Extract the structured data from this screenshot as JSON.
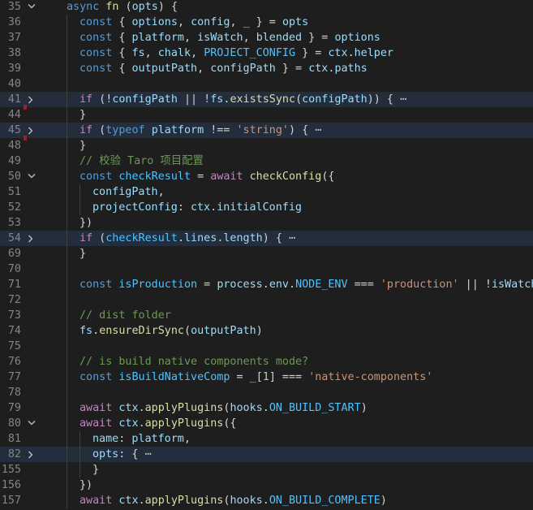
{
  "editor": {
    "colors": {
      "background": "#1e1e1e",
      "line_highlight": "#232d3c",
      "gutter_text": "#858585",
      "keyword": "#569cd6",
      "control": "#c586c0",
      "constant": "#4fc1ff",
      "variable": "#9cdcfe",
      "function": "#dcdcaa",
      "string": "#ce9178",
      "comment": "#6a9955",
      "plain": "#d4d4d4",
      "change_marker": "#a61c2a"
    },
    "lines": [
      {
        "num": "35",
        "indent": 0,
        "fold": "expanded",
        "highlight": false,
        "marker": false,
        "tokens": [
          [
            "kw",
            "async"
          ],
          [
            "op",
            " "
          ],
          [
            "fn",
            "fn"
          ],
          [
            "op",
            " ("
          ],
          [
            "var",
            "opts"
          ],
          [
            "op",
            ") {"
          ]
        ]
      },
      {
        "num": "36",
        "indent": 1,
        "fold": "none",
        "highlight": false,
        "marker": false,
        "tokens": [
          [
            "kw",
            "const"
          ],
          [
            "op",
            " { "
          ],
          [
            "var",
            "options"
          ],
          [
            "op",
            ", "
          ],
          [
            "var",
            "config"
          ],
          [
            "op",
            ", "
          ],
          [
            "var",
            "_"
          ],
          [
            "op",
            " } = "
          ],
          [
            "var",
            "opts"
          ]
        ]
      },
      {
        "num": "37",
        "indent": 1,
        "fold": "none",
        "highlight": false,
        "marker": false,
        "tokens": [
          [
            "kw",
            "const"
          ],
          [
            "op",
            " { "
          ],
          [
            "var",
            "platform"
          ],
          [
            "op",
            ", "
          ],
          [
            "var",
            "isWatch"
          ],
          [
            "op",
            ", "
          ],
          [
            "var",
            "blended"
          ],
          [
            "op",
            " } = "
          ],
          [
            "var",
            "options"
          ]
        ]
      },
      {
        "num": "38",
        "indent": 1,
        "fold": "none",
        "highlight": false,
        "marker": false,
        "tokens": [
          [
            "kw",
            "const"
          ],
          [
            "op",
            " { "
          ],
          [
            "var",
            "fs"
          ],
          [
            "op",
            ", "
          ],
          [
            "var",
            "chalk"
          ],
          [
            "op",
            ", "
          ],
          [
            "const",
            "PROJECT_CONFIG"
          ],
          [
            "op",
            " } = "
          ],
          [
            "var",
            "ctx"
          ],
          [
            "op",
            "."
          ],
          [
            "var",
            "helper"
          ]
        ]
      },
      {
        "num": "39",
        "indent": 1,
        "fold": "none",
        "highlight": false,
        "marker": false,
        "tokens": [
          [
            "kw",
            "const"
          ],
          [
            "op",
            " { "
          ],
          [
            "var",
            "outputPath"
          ],
          [
            "op",
            ", "
          ],
          [
            "var",
            "configPath"
          ],
          [
            "op",
            " } = "
          ],
          [
            "var",
            "ctx"
          ],
          [
            "op",
            "."
          ],
          [
            "var",
            "paths"
          ]
        ]
      },
      {
        "num": "40",
        "indent": 1,
        "fold": "none",
        "highlight": false,
        "marker": false,
        "tokens": []
      },
      {
        "num": "41",
        "indent": 1,
        "fold": "collapsed",
        "highlight": true,
        "marker": false,
        "tokens": [
          [
            "ctrl",
            "if"
          ],
          [
            "op",
            " (!"
          ],
          [
            "var",
            "configPath"
          ],
          [
            "op",
            " || !"
          ],
          [
            "var",
            "fs"
          ],
          [
            "op",
            "."
          ],
          [
            "fn",
            "existsSync"
          ],
          [
            "op",
            "("
          ],
          [
            "var",
            "configPath"
          ],
          [
            "op",
            ")) { "
          ],
          [
            "ell",
            "⋯"
          ]
        ]
      },
      {
        "num": "44",
        "indent": 1,
        "fold": "none",
        "highlight": false,
        "marker": true,
        "tokens": [
          [
            "op",
            "}"
          ]
        ]
      },
      {
        "num": "45",
        "indent": 1,
        "fold": "collapsed",
        "highlight": true,
        "marker": false,
        "tokens": [
          [
            "ctrl",
            "if"
          ],
          [
            "op",
            " ("
          ],
          [
            "kw",
            "typeof"
          ],
          [
            "op",
            " "
          ],
          [
            "var",
            "platform"
          ],
          [
            "op",
            " !== "
          ],
          [
            "str",
            "'string'"
          ],
          [
            "op",
            ") { "
          ],
          [
            "ell",
            "⋯"
          ]
        ]
      },
      {
        "num": "48",
        "indent": 1,
        "fold": "none",
        "highlight": false,
        "marker": true,
        "tokens": [
          [
            "op",
            "}"
          ]
        ]
      },
      {
        "num": "49",
        "indent": 1,
        "fold": "none",
        "highlight": false,
        "marker": false,
        "tokens": [
          [
            "com",
            "// 校验 Taro 项目配置"
          ]
        ]
      },
      {
        "num": "50",
        "indent": 1,
        "fold": "expanded",
        "highlight": false,
        "marker": false,
        "tokens": [
          [
            "kw",
            "const"
          ],
          [
            "op",
            " "
          ],
          [
            "const",
            "checkResult"
          ],
          [
            "op",
            " = "
          ],
          [
            "ctrl",
            "await"
          ],
          [
            "op",
            " "
          ],
          [
            "fn",
            "checkConfig"
          ],
          [
            "op",
            "({"
          ]
        ]
      },
      {
        "num": "51",
        "indent": 2,
        "fold": "none",
        "highlight": false,
        "marker": false,
        "tokens": [
          [
            "var",
            "configPath"
          ],
          [
            "op",
            ","
          ]
        ]
      },
      {
        "num": "52",
        "indent": 2,
        "fold": "none",
        "highlight": false,
        "marker": false,
        "tokens": [
          [
            "var",
            "projectConfig"
          ],
          [
            "op",
            ": "
          ],
          [
            "var",
            "ctx"
          ],
          [
            "op",
            "."
          ],
          [
            "var",
            "initialConfig"
          ]
        ]
      },
      {
        "num": "53",
        "indent": 1,
        "fold": "none",
        "highlight": false,
        "marker": false,
        "tokens": [
          [
            "op",
            "})"
          ]
        ]
      },
      {
        "num": "54",
        "indent": 1,
        "fold": "collapsed",
        "highlight": true,
        "marker": false,
        "tokens": [
          [
            "ctrl",
            "if"
          ],
          [
            "op",
            " ("
          ],
          [
            "const",
            "checkResult"
          ],
          [
            "op",
            "."
          ],
          [
            "var",
            "lines"
          ],
          [
            "op",
            "."
          ],
          [
            "var",
            "length"
          ],
          [
            "op",
            ") { "
          ],
          [
            "ell",
            "⋯"
          ]
        ]
      },
      {
        "num": "69",
        "indent": 1,
        "fold": "none",
        "highlight": false,
        "marker": false,
        "tokens": [
          [
            "op",
            "}"
          ]
        ]
      },
      {
        "num": "70",
        "indent": 1,
        "fold": "none",
        "highlight": false,
        "marker": false,
        "tokens": []
      },
      {
        "num": "71",
        "indent": 1,
        "fold": "none",
        "highlight": false,
        "marker": false,
        "tokens": [
          [
            "kw",
            "const"
          ],
          [
            "op",
            " "
          ],
          [
            "const",
            "isProduction"
          ],
          [
            "op",
            " = "
          ],
          [
            "var",
            "process"
          ],
          [
            "op",
            "."
          ],
          [
            "var",
            "env"
          ],
          [
            "op",
            "."
          ],
          [
            "const",
            "NODE_ENV"
          ],
          [
            "op",
            " === "
          ],
          [
            "str",
            "'production'"
          ],
          [
            "op",
            " || !"
          ],
          [
            "var",
            "isWatch"
          ]
        ]
      },
      {
        "num": "72",
        "indent": 1,
        "fold": "none",
        "highlight": false,
        "marker": false,
        "tokens": []
      },
      {
        "num": "73",
        "indent": 1,
        "fold": "none",
        "highlight": false,
        "marker": false,
        "tokens": [
          [
            "com",
            "// dist folder"
          ]
        ]
      },
      {
        "num": "74",
        "indent": 1,
        "fold": "none",
        "highlight": false,
        "marker": false,
        "tokens": [
          [
            "var",
            "fs"
          ],
          [
            "op",
            "."
          ],
          [
            "fn",
            "ensureDirSync"
          ],
          [
            "op",
            "("
          ],
          [
            "var",
            "outputPath"
          ],
          [
            "op",
            ")"
          ]
        ]
      },
      {
        "num": "75",
        "indent": 1,
        "fold": "none",
        "highlight": false,
        "marker": false,
        "tokens": []
      },
      {
        "num": "76",
        "indent": 1,
        "fold": "none",
        "highlight": false,
        "marker": false,
        "tokens": [
          [
            "com",
            "// is build native components mode?"
          ]
        ]
      },
      {
        "num": "77",
        "indent": 1,
        "fold": "none",
        "highlight": false,
        "marker": false,
        "tokens": [
          [
            "kw",
            "const"
          ],
          [
            "op",
            " "
          ],
          [
            "const",
            "isBuildNativeComp"
          ],
          [
            "op",
            " = "
          ],
          [
            "var",
            "_"
          ],
          [
            "op",
            "["
          ],
          [
            "num",
            "1"
          ],
          [
            "op",
            "] === "
          ],
          [
            "str",
            "'native-components'"
          ]
        ]
      },
      {
        "num": "78",
        "indent": 1,
        "fold": "none",
        "highlight": false,
        "marker": false,
        "tokens": []
      },
      {
        "num": "79",
        "indent": 1,
        "fold": "none",
        "highlight": false,
        "marker": false,
        "tokens": [
          [
            "ctrl",
            "await"
          ],
          [
            "op",
            " "
          ],
          [
            "var",
            "ctx"
          ],
          [
            "op",
            "."
          ],
          [
            "fn",
            "applyPlugins"
          ],
          [
            "op",
            "("
          ],
          [
            "var",
            "hooks"
          ],
          [
            "op",
            "."
          ],
          [
            "const",
            "ON_BUILD_START"
          ],
          [
            "op",
            ")"
          ]
        ]
      },
      {
        "num": "80",
        "indent": 1,
        "fold": "expanded",
        "highlight": false,
        "marker": false,
        "tokens": [
          [
            "ctrl",
            "await"
          ],
          [
            "op",
            " "
          ],
          [
            "var",
            "ctx"
          ],
          [
            "op",
            "."
          ],
          [
            "fn",
            "applyPlugins"
          ],
          [
            "op",
            "({"
          ]
        ]
      },
      {
        "num": "81",
        "indent": 2,
        "fold": "none",
        "highlight": false,
        "marker": false,
        "tokens": [
          [
            "var",
            "name"
          ],
          [
            "op",
            ": "
          ],
          [
            "var",
            "platform"
          ],
          [
            "op",
            ","
          ]
        ]
      },
      {
        "num": "82",
        "indent": 2,
        "fold": "collapsed",
        "highlight": true,
        "marker": false,
        "tokens": [
          [
            "var",
            "opts"
          ],
          [
            "op",
            ": { "
          ],
          [
            "ell",
            "⋯"
          ]
        ]
      },
      {
        "num": "155",
        "indent": 2,
        "fold": "none",
        "highlight": false,
        "marker": false,
        "tokens": [
          [
            "op",
            "}"
          ]
        ]
      },
      {
        "num": "156",
        "indent": 1,
        "fold": "none",
        "highlight": false,
        "marker": false,
        "tokens": [
          [
            "op",
            "})"
          ]
        ]
      },
      {
        "num": "157",
        "indent": 1,
        "fold": "none",
        "highlight": false,
        "marker": false,
        "tokens": [
          [
            "ctrl",
            "await"
          ],
          [
            "op",
            " "
          ],
          [
            "var",
            "ctx"
          ],
          [
            "op",
            "."
          ],
          [
            "fn",
            "applyPlugins"
          ],
          [
            "op",
            "("
          ],
          [
            "var",
            "hooks"
          ],
          [
            "op",
            "."
          ],
          [
            "const",
            "ON_BUILD_COMPLETE"
          ],
          [
            "op",
            ")"
          ]
        ]
      }
    ]
  }
}
